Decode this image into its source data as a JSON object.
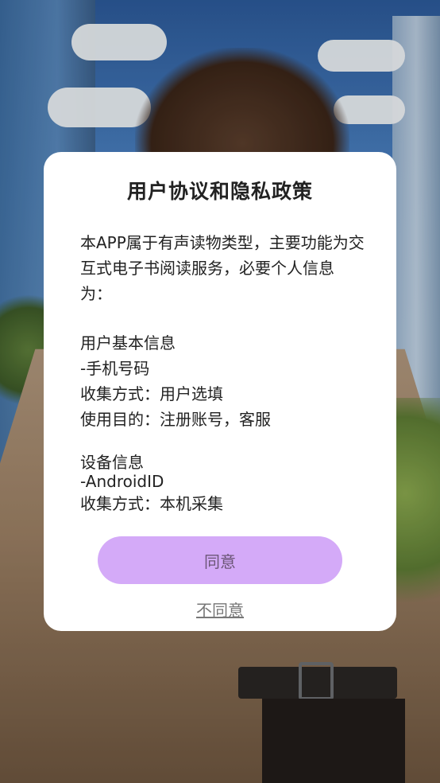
{
  "dialog": {
    "title": "用户协议和隐私政策",
    "intro": "本APP属于有声读物类型，主要功能为交互式电子书阅读服务，必要个人信息为：",
    "section1": {
      "heading": "用户基本信息",
      "item": "-手机号码",
      "method": "收集方式：用户选填",
      "purpose": "使用目的：注册账号，客服"
    },
    "section2": {
      "heading": "设备信息",
      "item": "-AndroidID",
      "method": "收集方式：本机采集"
    },
    "agree_label": "同意",
    "disagree_label": "不同意"
  },
  "colors": {
    "agree_button_bg": "#d4aaf8",
    "agree_button_text": "#6b5576",
    "dialog_bg": "#ffffff"
  }
}
